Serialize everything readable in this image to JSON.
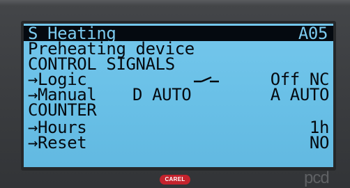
{
  "screen": {
    "title": "S Heating",
    "code": "A05",
    "subtitle": "Preheating device",
    "section_control": "CONTROL SIGNALS",
    "logic_label": "→Logic",
    "logic_value": "Off NC",
    "manual_label": "→Manual",
    "manual_digital": "D AUTO",
    "manual_analog": "A AUTO",
    "section_counter": "COUNTER",
    "hours_label": "→Hours",
    "hours_value": "1h",
    "reset_label": "→Reset",
    "reset_value": "NO"
  },
  "device": {
    "brand_badge": "CAREL",
    "model_logo": "pcd"
  },
  "colors": {
    "lcd_background": "#6ec3e9",
    "lcd_text": "#050a10",
    "bezel": "#3e4043",
    "brand_red": "#c4232d"
  },
  "icons": {
    "logic_state": "open-contact-switch-icon"
  }
}
